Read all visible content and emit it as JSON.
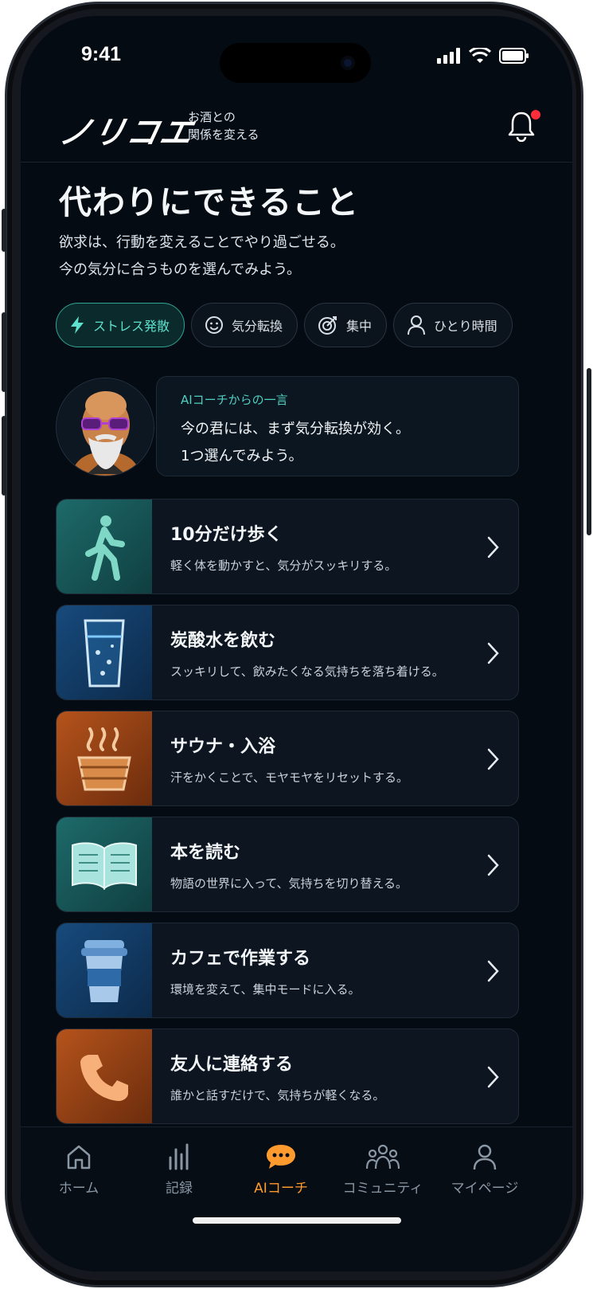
{
  "status": {
    "time": "9:41"
  },
  "header": {
    "logo": "ノリコエ",
    "tagline_line1": "お酒との",
    "tagline_line2": "関係を変える",
    "bell_icon": "bell-icon"
  },
  "page": {
    "title": "代わりにできること",
    "subtitle_line1": "欲求は、行動を変えることでやり過ごせる。",
    "subtitle_line2": "今の気分に合うものを選んでみよう。"
  },
  "chips": [
    {
      "label": "ストレス発散",
      "icon": "lightning-icon",
      "active": true
    },
    {
      "label": "気分転換",
      "icon": "smile-icon",
      "active": false
    },
    {
      "label": "集中",
      "icon": "target-icon",
      "active": false
    },
    {
      "label": "ひとり時間",
      "icon": "person-icon",
      "active": false
    }
  ],
  "coach": {
    "label": "AIコーチからの一言",
    "line1": "今の君には、まず気分転換が効く。",
    "line2": "1つ選んでみよう。"
  },
  "activities": [
    {
      "title": "10分だけ歩く",
      "desc": "軽く体を動かすと、気分がスッキリする。",
      "icon": "walking-person-icon",
      "color": "teal"
    },
    {
      "title": "炭酸水を飲む",
      "desc": "スッキリして、飲みたくなる気持ちを落ち着ける。",
      "icon": "sparkling-water-glass-icon",
      "color": "blue"
    },
    {
      "title": "サウナ・入浴",
      "desc": "汗をかくことで、モヤモヤをリセットする。",
      "icon": "sauna-bucket-icon",
      "color": "orange"
    },
    {
      "title": "本を読む",
      "desc": "物語の世界に入って、気持ちを切り替える。",
      "icon": "open-book-icon",
      "color": "teal"
    },
    {
      "title": "カフェで作業する",
      "desc": "環境を変えて、集中モードに入る。",
      "icon": "coffee-cup-icon",
      "color": "blue"
    },
    {
      "title": "友人に連絡する",
      "desc": "誰かと話すだけで、気持ちが軽くなる。",
      "icon": "phone-icon",
      "color": "orange"
    }
  ],
  "tabs": [
    {
      "label": "ホーム",
      "icon": "home-icon"
    },
    {
      "label": "記録",
      "icon": "bar-chart-icon"
    },
    {
      "label": "AIコーチ",
      "icon": "chat-bubble-icon",
      "active": true
    },
    {
      "label": "コミュニティ",
      "icon": "community-icon"
    },
    {
      "label": "マイページ",
      "icon": "user-icon"
    }
  ],
  "colors": {
    "accent": "#4fcfc0",
    "active_tab": "#ff9a2e",
    "background": "#050b12",
    "notification": "#ff2d3a"
  }
}
